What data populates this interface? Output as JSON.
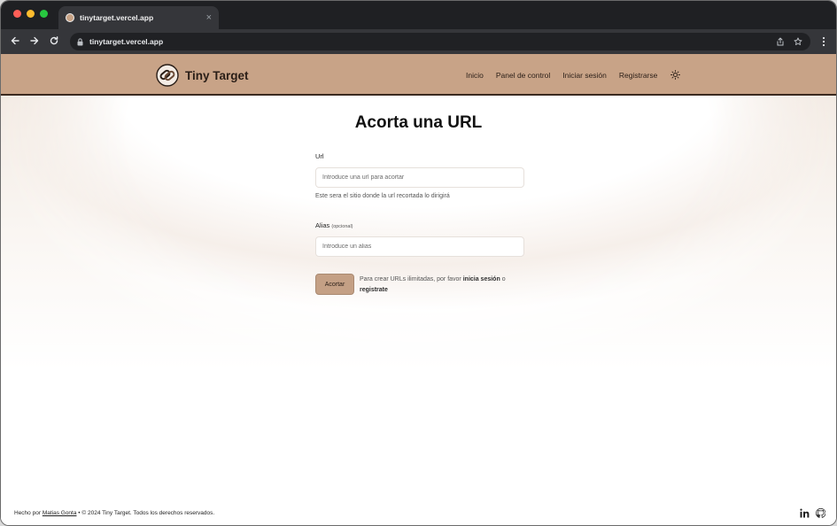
{
  "browser": {
    "tab_title": "tinytarget.vercel.app",
    "address": "tinytarget.vercel.app"
  },
  "header": {
    "brand": "Tiny Target",
    "nav": [
      "Inicio",
      "Panel de control",
      "Iniciar sesión",
      "Registrarse"
    ]
  },
  "form": {
    "title": "Acorta una URL",
    "url_label": "Url",
    "url_placeholder": "Introduce una url para acortar",
    "url_help": "Este sera el sitio donde la url recortada lo dirigirá",
    "alias_label": "Alias",
    "alias_optional": "(opcional)",
    "alias_placeholder": "Introduce un alias",
    "submit_label": "Acortar",
    "note_prefix": "Para crear URLs ilimitadas, por favor",
    "note_login": "inicia sesión",
    "note_or": "o",
    "note_register": "registrate"
  },
  "footer": {
    "made_by": "Hecho por",
    "author": "Matias Gonta",
    "copyright": "• © 2024 Tiny Target. Todos los derechos reservados."
  },
  "colors": {
    "header_bg": "#c8a387",
    "button_bg": "#c4a085",
    "header_border": "#3b2a20"
  }
}
